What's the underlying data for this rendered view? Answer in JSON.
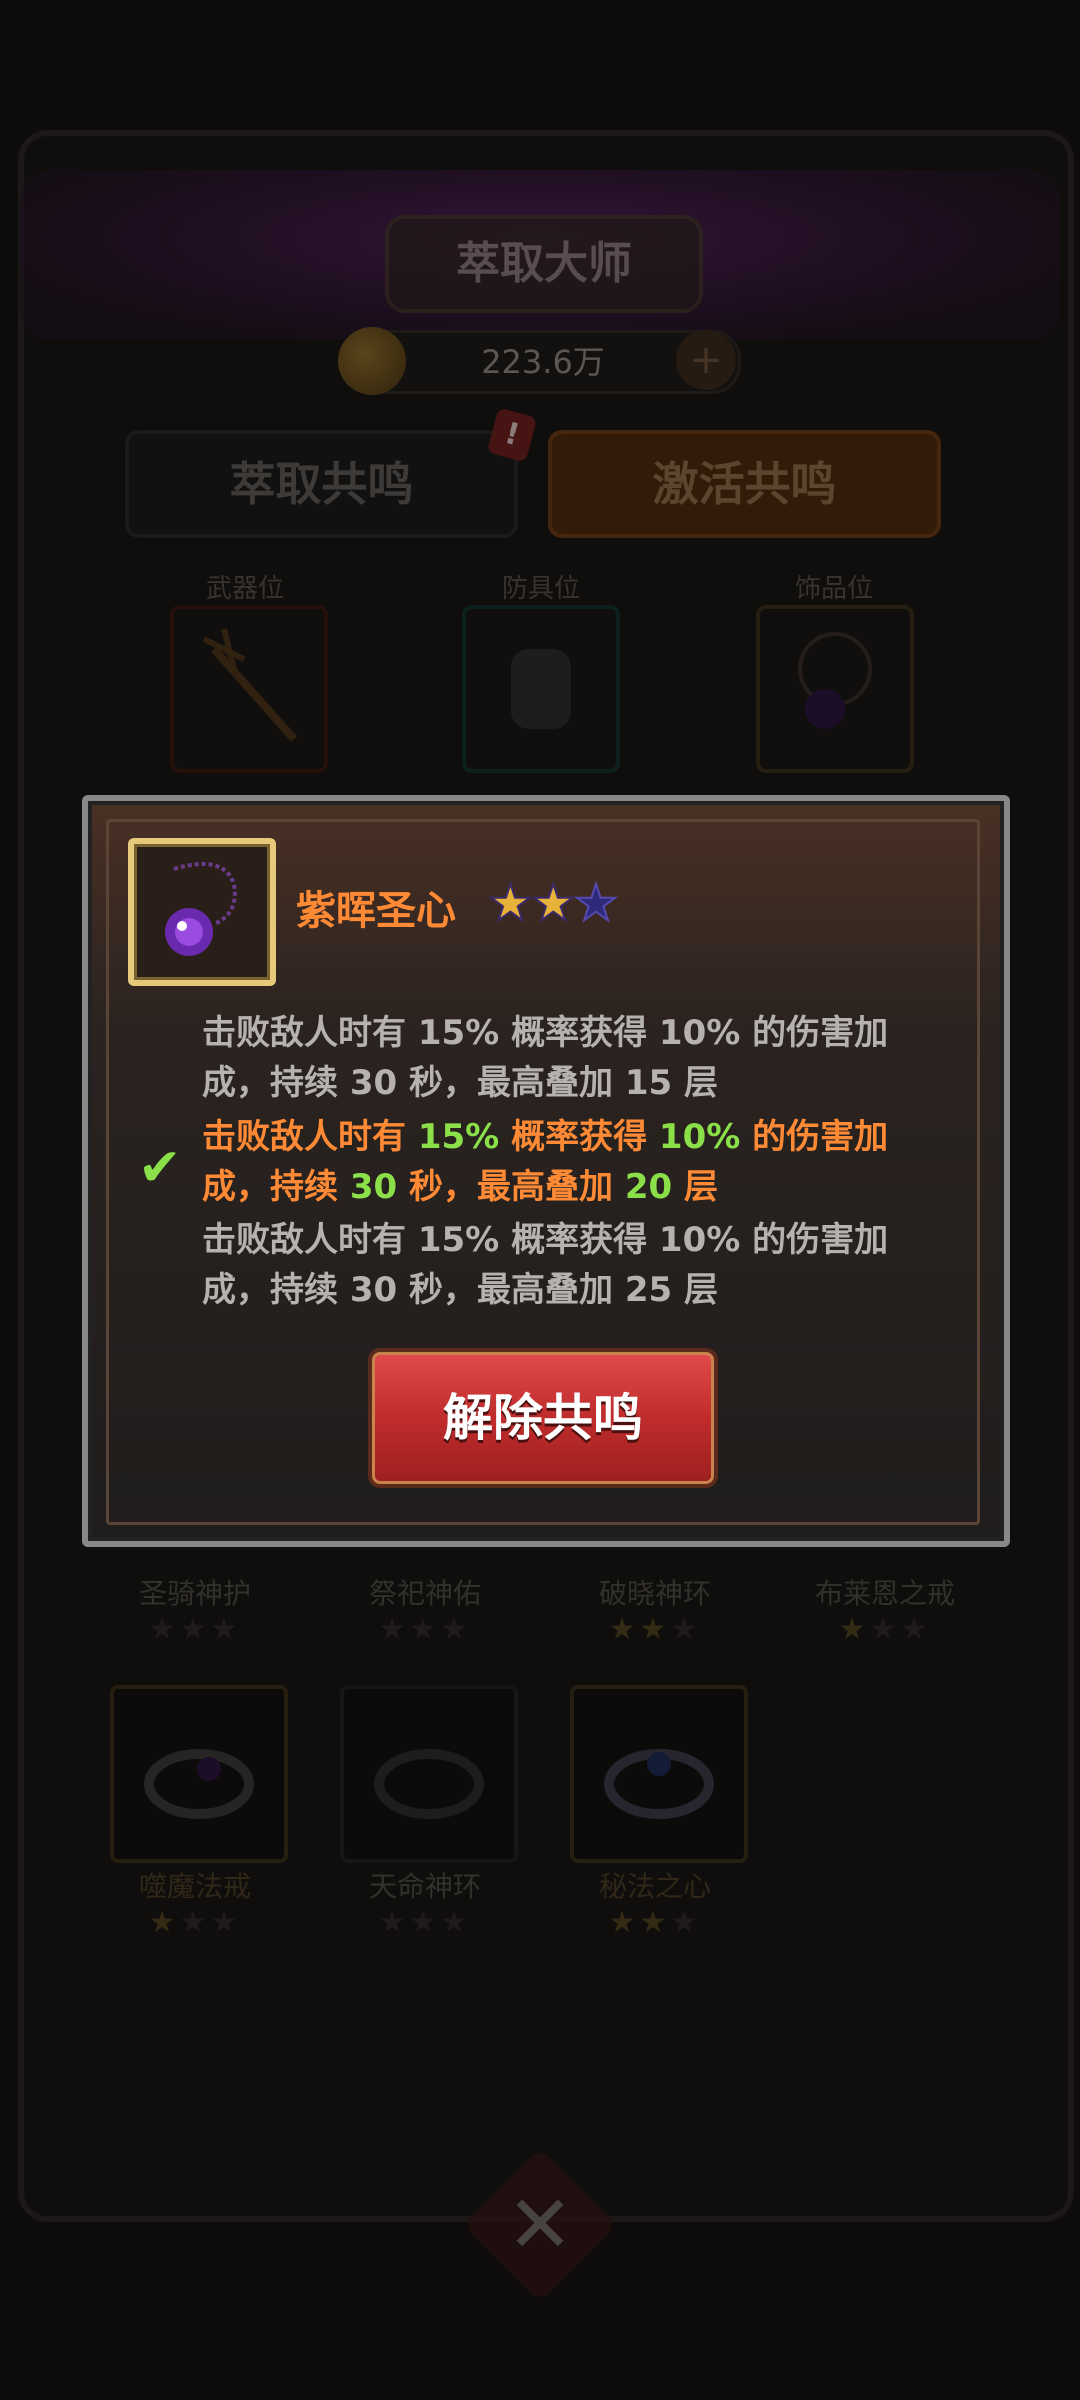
{
  "header": {
    "title": "萃取大师",
    "currency": "223.6万"
  },
  "tabs": [
    {
      "label": "萃取共鸣"
    },
    {
      "label": "激活共鸣"
    }
  ],
  "slots": [
    {
      "label": "武器位"
    },
    {
      "label": "防具位"
    },
    {
      "label": "饰品位"
    }
  ],
  "grid": [
    {
      "name": "圣骑神护",
      "stars": 0
    },
    {
      "name": "祭祀神佑",
      "stars": 0
    },
    {
      "name": "破晓神环",
      "stars": 2
    },
    {
      "name": "布莱恩之戒",
      "stars": 1
    },
    {
      "name": "噬魔法戒",
      "stars": 1
    },
    {
      "name": "天命神环",
      "stars": 0
    },
    {
      "name": "秘法之心",
      "stars": 2
    }
  ],
  "dialog": {
    "item_name": "紫晖圣心",
    "stars_filled": 2,
    "stars_total": 3,
    "effects": [
      {
        "prefix": "击败敌人时有",
        "chance": "15%",
        "mid": "概率获得",
        "bonus": "10%",
        "suffix1": "的伤害加",
        "line2a": "成，持续",
        "duration": "30",
        "line2b": "秒，最高叠加",
        "stack": "15",
        "unit": "层",
        "active": false
      },
      {
        "prefix": "击败敌人时有",
        "chance": "15%",
        "mid": "概率获得",
        "bonus": "10%",
        "suffix1": "的伤害加",
        "line2a": "成，持续",
        "duration": "30",
        "line2b": "秒，最高叠加",
        "stack": "20",
        "unit": "层",
        "active": true
      },
      {
        "prefix": "击败敌人时有",
        "chance": "15%",
        "mid": "概率获得",
        "bonus": "10%",
        "suffix1": "的伤害加",
        "line2a": "成，持续",
        "duration": "30",
        "line2b": "秒，最高叠加",
        "stack": "25",
        "unit": "层",
        "active": false
      }
    ],
    "button_label": "解除共鸣"
  },
  "colors": {
    "name_orange": "#ff8a35",
    "value_green": "#8be04a",
    "button_red": "#c02c2c"
  }
}
